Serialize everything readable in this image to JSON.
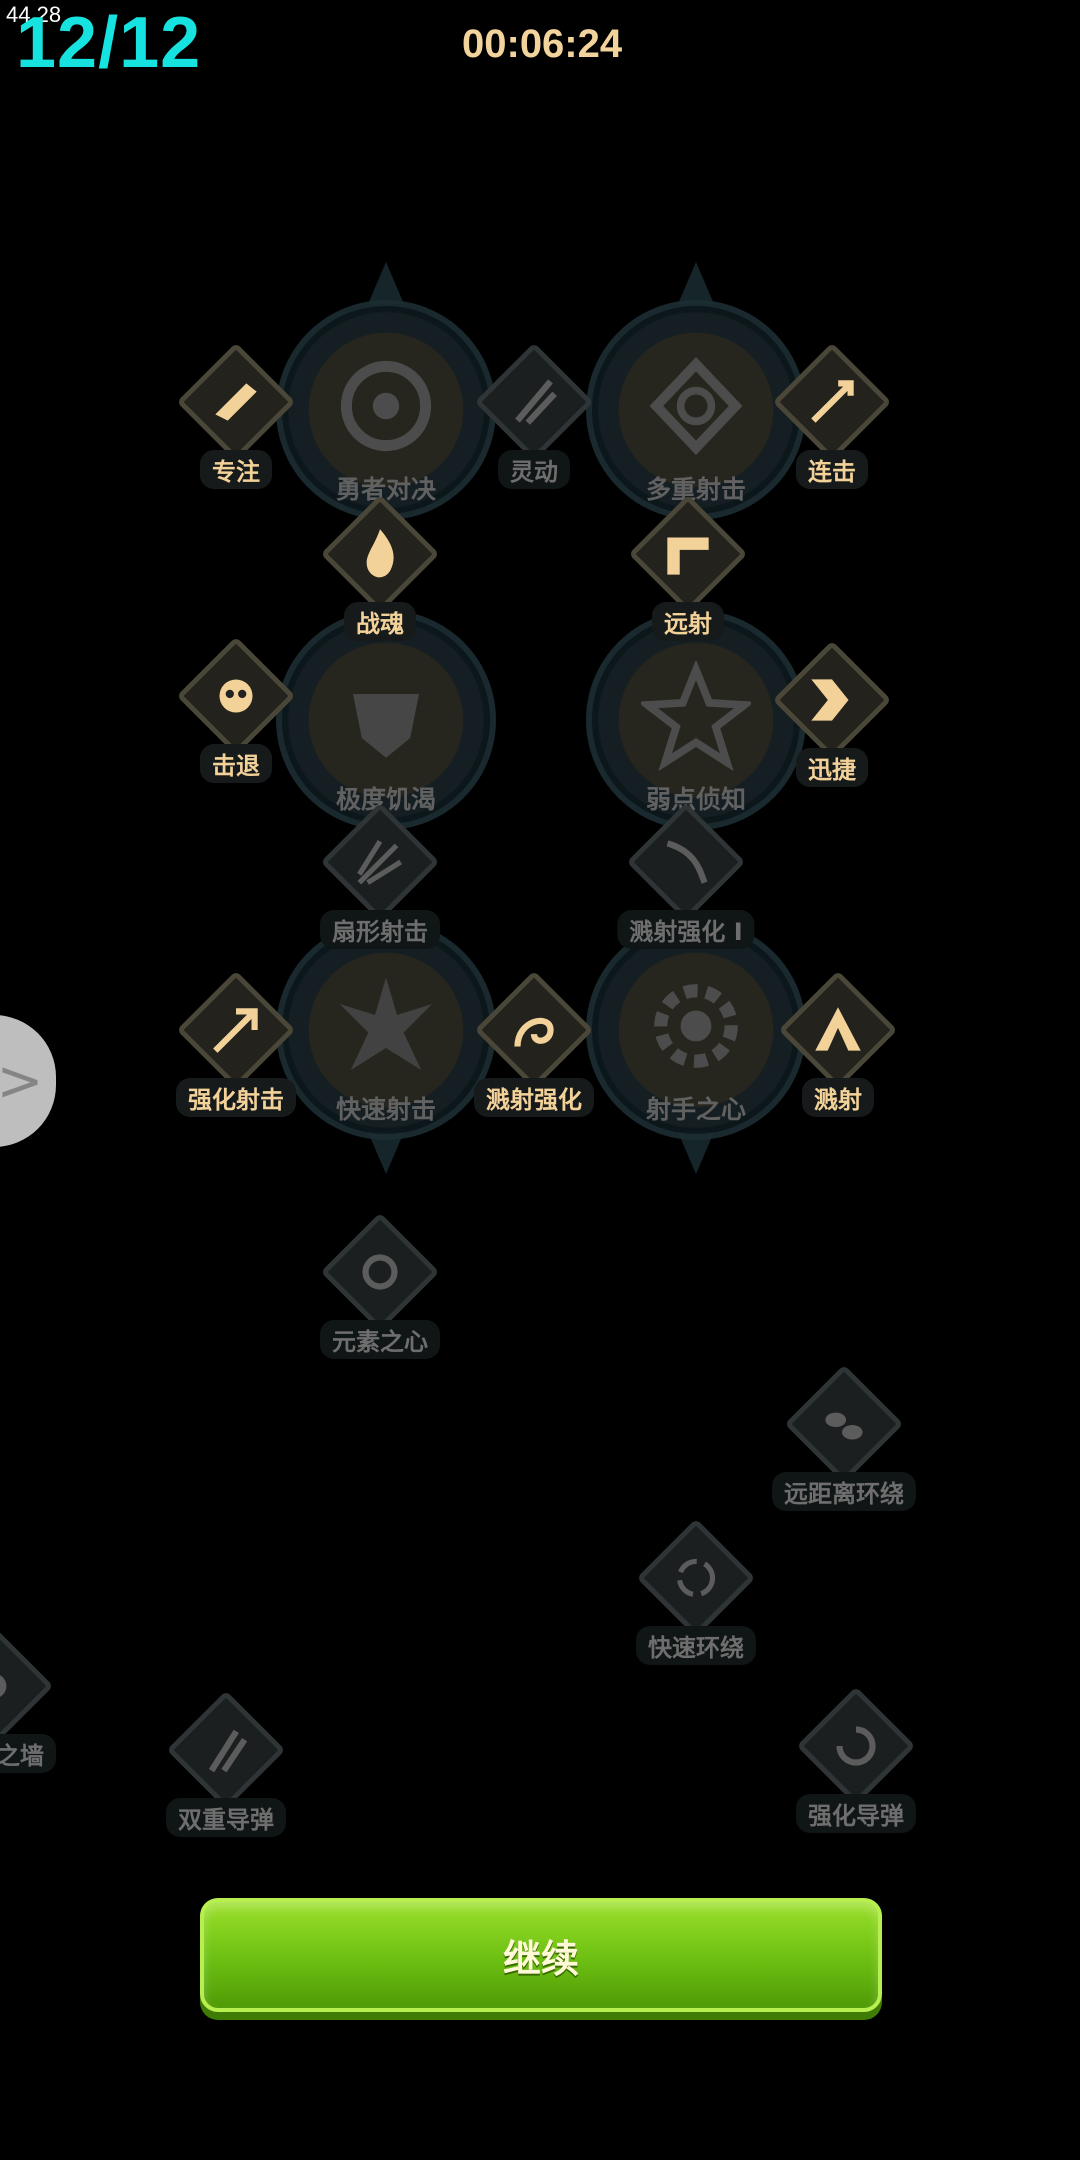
{
  "hud": {
    "fps": "44.28",
    "counter": "12/12",
    "timer": "00:06:24"
  },
  "big_nodes": [
    {
      "label": "勇者对决",
      "icon": "eye-emblem-icon"
    },
    {
      "label": "多重射击",
      "icon": "knot-emblem-icon"
    },
    {
      "label": "极度饥渴",
      "icon": "fist-emblem-icon"
    },
    {
      "label": "弱点侦知",
      "icon": "star-emblem-icon"
    },
    {
      "label": "快速射击",
      "icon": "spiky-emblem-icon"
    },
    {
      "label": "射手之心",
      "icon": "gear-emblem-icon"
    }
  ],
  "small_nodes": [
    {
      "label": "专注",
      "active": true,
      "icon": "hand-icon"
    },
    {
      "label": "灵动",
      "active": false,
      "icon": "slash-icon"
    },
    {
      "label": "连击",
      "active": true,
      "icon": "arrows-icon"
    },
    {
      "label": "战魂",
      "active": true,
      "icon": "flame-icon"
    },
    {
      "label": "远射",
      "active": true,
      "icon": "chevron-icon"
    },
    {
      "label": "击退",
      "active": true,
      "icon": "skull-icon"
    },
    {
      "label": "迅捷",
      "active": true,
      "icon": "double-chevron-icon"
    },
    {
      "label": "扇形射击",
      "active": false,
      "icon": "fan-arrows-icon"
    },
    {
      "label": "溅射强化 I",
      "active": false,
      "icon": "bow-icon"
    },
    {
      "label": "强化射击",
      "active": true,
      "icon": "crossbow-icon"
    },
    {
      "label": "溅射强化",
      "active": true,
      "icon": "hook-icon"
    },
    {
      "label": "溅射",
      "active": true,
      "icon": "peak-icon"
    },
    {
      "label": "元素之心",
      "active": false,
      "icon": "orb-icon"
    },
    {
      "label": "远距离环绕",
      "active": false,
      "icon": "bullets-icon"
    },
    {
      "label": "快速环绕",
      "active": false,
      "icon": "triskelion-icon"
    },
    {
      "label": "之墙",
      "active": false,
      "icon": "wall-icon"
    },
    {
      "label": "双重导弹",
      "active": false,
      "icon": "missile-icon"
    },
    {
      "label": "强化导弹",
      "active": false,
      "icon": "swirl-icon"
    }
  ],
  "continue_button": {
    "label": "继续"
  },
  "side_tab": {
    "icon": "chevron-right-icon"
  }
}
